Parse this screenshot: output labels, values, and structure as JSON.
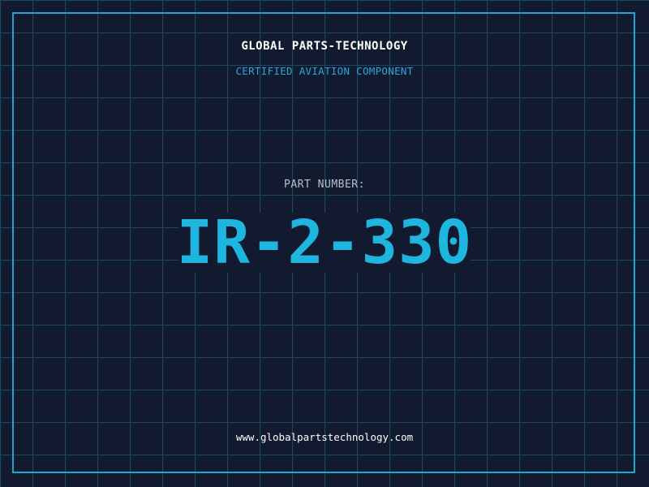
{
  "header": {
    "company": "GLOBAL PARTS-TECHNOLOGY",
    "subtitle": "CERTIFIED AVIATION COMPONENT"
  },
  "part": {
    "label": "PART NUMBER:",
    "number": "IR-2-330"
  },
  "footer": {
    "website": "www.globalpartstechnology.com"
  },
  "colors": {
    "background": "#111a2f",
    "grid": "#1a4a63",
    "frame": "#1ba8cc",
    "accent": "#1eb6df",
    "subtitle": "#29a6d6",
    "label": "#b8bfca",
    "text": "#ffffff"
  }
}
